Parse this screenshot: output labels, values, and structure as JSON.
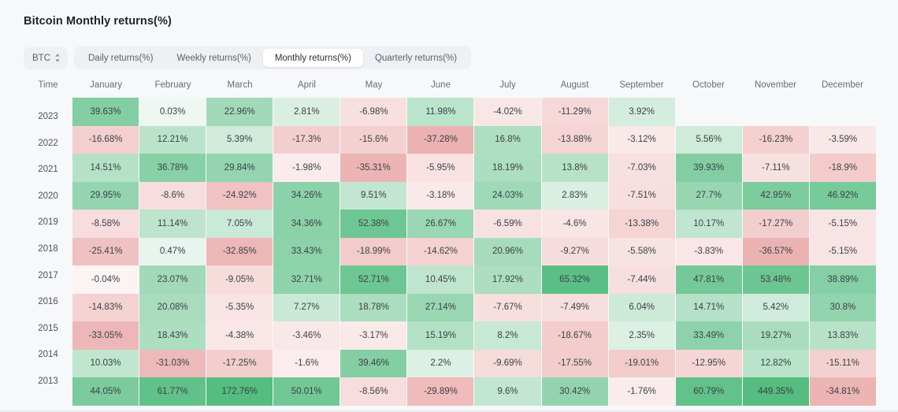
{
  "header": {
    "title": "Bitcoin Monthly returns(%)"
  },
  "controls": {
    "symbol": "BTC",
    "symbol_icon": "chevron-up-down-icon",
    "tabs": [
      {
        "label": "Daily returns(%)",
        "active": false
      },
      {
        "label": "Weekly returns(%)",
        "active": false
      },
      {
        "label": "Monthly returns(%)",
        "active": true
      },
      {
        "label": "Quarterly returns(%)",
        "active": false
      }
    ]
  },
  "colors": {
    "page_background": "#f7f8fa",
    "cell_neutral": "#fbfbfc",
    "positive_max": "#57bd80",
    "positive_min": "#eef7f1",
    "negative_max": "#eeb3b3",
    "negative_min": "#fbf1f1",
    "text": "#3c4248",
    "muted_text": "#666d76",
    "tab_group_background": "#eef0f3",
    "tab_active_background": "#ffffff"
  },
  "chart_data": {
    "type": "heatmap",
    "title": "Bitcoin Monthly returns(%)",
    "xlabel": "",
    "ylabel": "Time",
    "unit": "%",
    "grid": false,
    "legend": "none",
    "row_header_label": "Time",
    "columns": [
      "January",
      "February",
      "March",
      "April",
      "May",
      "June",
      "July",
      "August",
      "September",
      "October",
      "November",
      "December"
    ],
    "rows": [
      {
        "year": "2023",
        "values": [
          39.63,
          0.03,
          22.96,
          2.81,
          -6.98,
          11.98,
          -4.02,
          -11.29,
          3.92,
          null,
          null,
          null
        ],
        "labels": [
          "39.63%",
          "0.03%",
          "22.96%",
          "2.81%",
          "-6.98%",
          "11.98%",
          "-4.02%",
          "-11.29%",
          "3.92%",
          "",
          "",
          ""
        ]
      },
      {
        "year": "2022",
        "values": [
          -16.68,
          12.21,
          5.39,
          -17.3,
          -15.6,
          -37.28,
          16.8,
          -13.88,
          -3.12,
          5.56,
          -16.23,
          -3.59
        ],
        "labels": [
          "-16.68%",
          "12.21%",
          "5.39%",
          "-17.3%",
          "-15.6%",
          "-37.28%",
          "16.8%",
          "-13.88%",
          "-3.12%",
          "5.56%",
          "-16.23%",
          "-3.59%"
        ]
      },
      {
        "year": "2021",
        "values": [
          14.51,
          36.78,
          29.84,
          -1.98,
          -35.31,
          -5.95,
          18.19,
          13.8,
          -7.03,
          39.93,
          -7.11,
          -18.9
        ],
        "labels": [
          "14.51%",
          "36.78%",
          "29.84%",
          "-1.98%",
          "-35.31%",
          "-5.95%",
          "18.19%",
          "13.8%",
          "-7.03%",
          "39.93%",
          "-7.11%",
          "-18.9%"
        ]
      },
      {
        "year": "2020",
        "values": [
          29.95,
          -8.6,
          -24.92,
          34.26,
          9.51,
          -3.18,
          24.03,
          2.83,
          -7.51,
          27.7,
          42.95,
          46.92
        ],
        "labels": [
          "29.95%",
          "-8.6%",
          "-24.92%",
          "34.26%",
          "9.51%",
          "-3.18%",
          "24.03%",
          "2.83%",
          "-7.51%",
          "27.7%",
          "42.95%",
          "46.92%"
        ]
      },
      {
        "year": "2019",
        "values": [
          -8.58,
          11.14,
          7.05,
          34.36,
          52.38,
          26.67,
          -6.59,
          -4.6,
          -13.38,
          10.17,
          -17.27,
          -5.15
        ],
        "labels": [
          "-8.58%",
          "11.14%",
          "7.05%",
          "34.36%",
          "52.38%",
          "26.67%",
          "-6.59%",
          "-4.6%",
          "-13.38%",
          "10.17%",
          "-17.27%",
          "-5.15%"
        ]
      },
      {
        "year": "2018",
        "values": [
          -25.41,
          0.47,
          -32.85,
          33.43,
          -18.99,
          -14.62,
          20.96,
          -9.27,
          -5.58,
          -3.83,
          -36.57,
          -5.15
        ],
        "labels": [
          "-25.41%",
          "0.47%",
          "-32.85%",
          "33.43%",
          "-18.99%",
          "-14.62%",
          "20.96%",
          "-9.27%",
          "-5.58%",
          "-3.83%",
          "-36.57%",
          "-5.15%"
        ]
      },
      {
        "year": "2017",
        "values": [
          -0.04,
          23.07,
          -9.05,
          32.71,
          52.71,
          10.45,
          17.92,
          65.32,
          -7.44,
          47.81,
          53.48,
          38.89
        ],
        "labels": [
          "-0.04%",
          "23.07%",
          "-9.05%",
          "32.71%",
          "52.71%",
          "10.45%",
          "17.92%",
          "65.32%",
          "-7.44%",
          "47.81%",
          "53.48%",
          "38.89%"
        ]
      },
      {
        "year": "2016",
        "values": [
          -14.83,
          20.08,
          -5.35,
          7.27,
          18.78,
          27.14,
          -7.67,
          -7.49,
          6.04,
          14.71,
          5.42,
          30.8
        ],
        "labels": [
          "-14.83%",
          "20.08%",
          "-5.35%",
          "7.27%",
          "18.78%",
          "27.14%",
          "-7.67%",
          "-7.49%",
          "6.04%",
          "14.71%",
          "5.42%",
          "30.8%"
        ]
      },
      {
        "year": "2015",
        "values": [
          -33.05,
          18.43,
          -4.38,
          -3.46,
          -3.17,
          15.19,
          8.2,
          -18.67,
          2.35,
          33.49,
          19.27,
          13.83
        ],
        "labels": [
          "-33.05%",
          "18.43%",
          "-4.38%",
          "-3.46%",
          "-3.17%",
          "15.19%",
          "8.2%",
          "-18.67%",
          "2.35%",
          "33.49%",
          "19.27%",
          "13.83%"
        ]
      },
      {
        "year": "2014",
        "values": [
          10.03,
          -31.03,
          -17.25,
          -1.6,
          39.46,
          2.2,
          -9.69,
          -17.55,
          -19.01,
          -12.95,
          12.82,
          -15.11
        ],
        "labels": [
          "10.03%",
          "-31.03%",
          "-17.25%",
          "-1.6%",
          "39.46%",
          "2.2%",
          "-9.69%",
          "-17.55%",
          "-19.01%",
          "-12.95%",
          "12.82%",
          "-15.11%"
        ]
      },
      {
        "year": "2013",
        "values": [
          44.05,
          61.77,
          172.76,
          50.01,
          -8.56,
          -29.89,
          9.6,
          30.42,
          -1.76,
          60.79,
          449.35,
          -34.81
        ],
        "labels": [
          "44.05%",
          "61.77%",
          "172.76%",
          "50.01%",
          "-8.56%",
          "-29.89%",
          "9.6%",
          "30.42%",
          "-1.76%",
          "60.79%",
          "449.35%",
          "-34.81%"
        ]
      }
    ]
  }
}
